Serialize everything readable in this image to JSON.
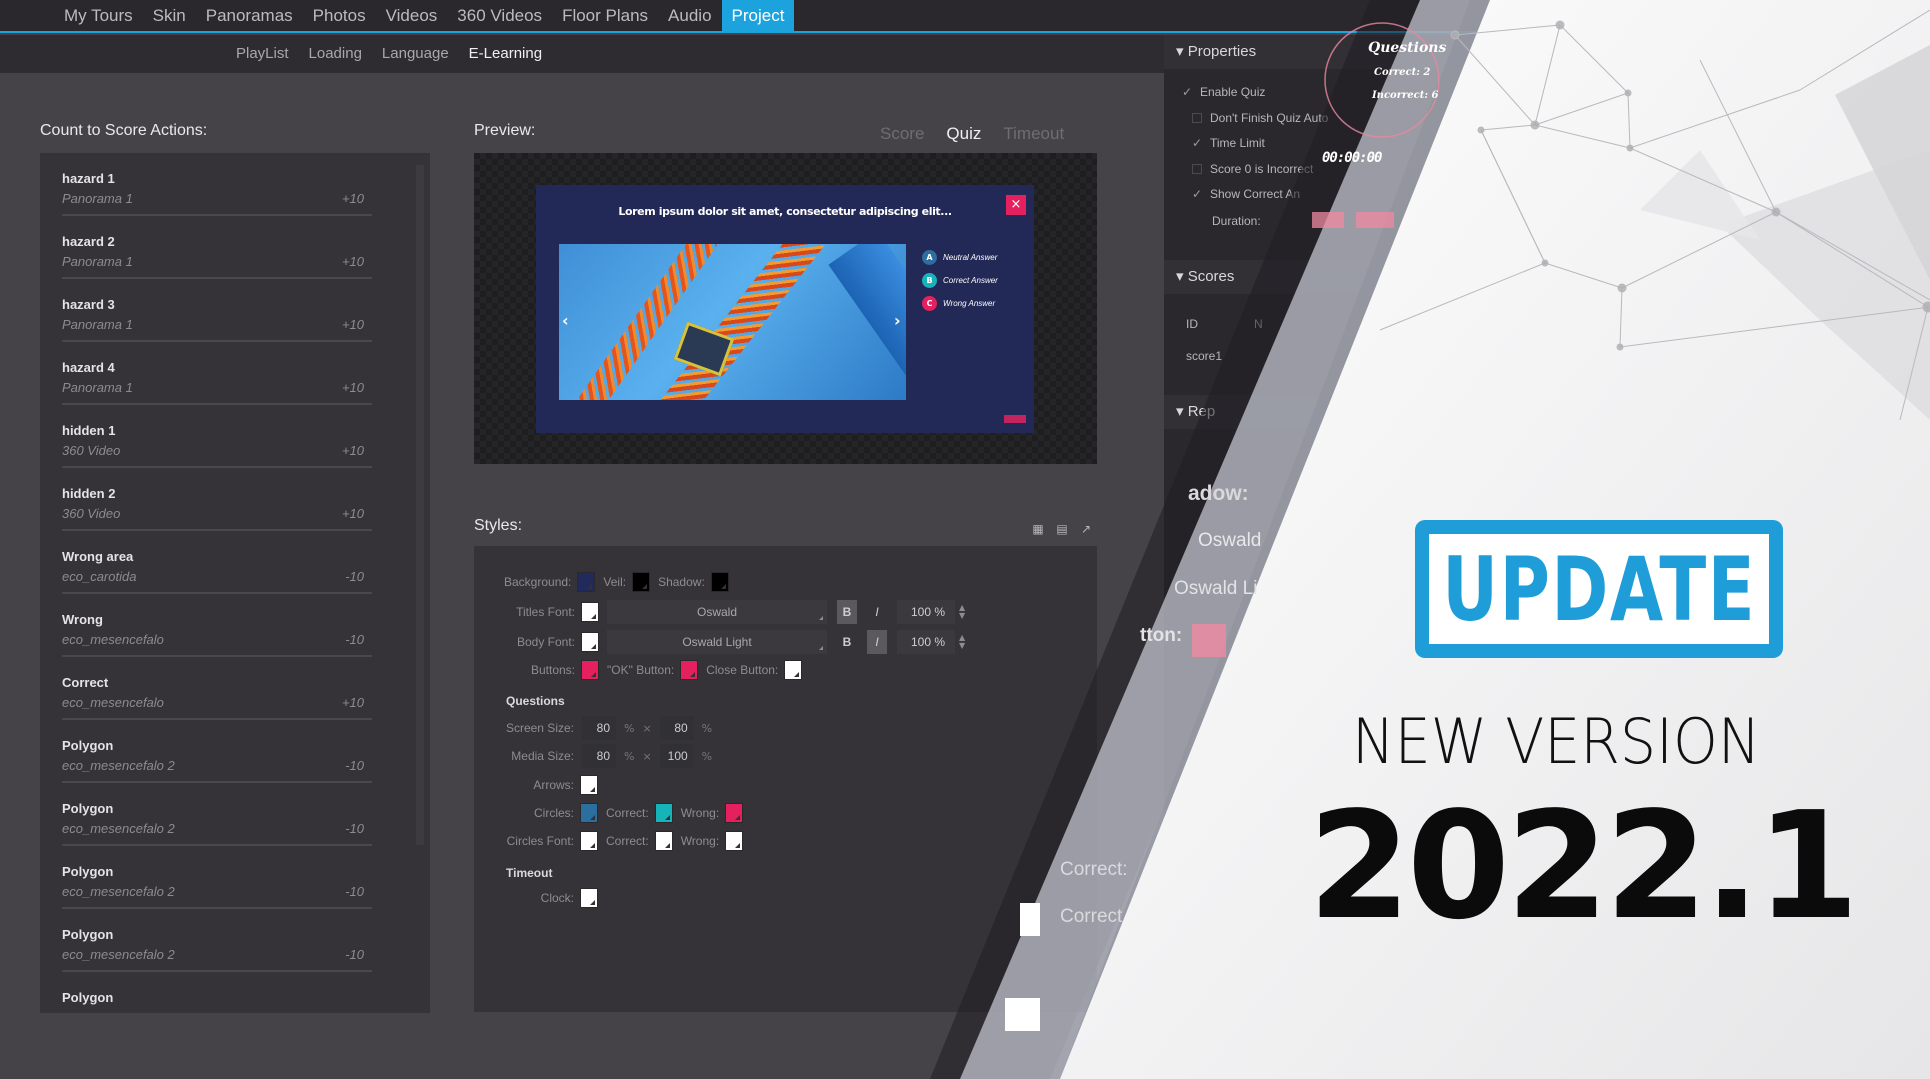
{
  "topnav": {
    "tabs": [
      "My Tours",
      "Skin",
      "Panoramas",
      "Photos",
      "Videos",
      "360 Videos",
      "Floor Plans",
      "Audio",
      "Project"
    ],
    "active": "Project",
    "accent": "#1ca3dd"
  },
  "subnav": {
    "tabs": [
      "PlayList",
      "Loading",
      "Language",
      "E-Learning"
    ],
    "active": "E-Learning"
  },
  "score_actions": {
    "title": "Count to Score Actions:",
    "items": [
      {
        "name": "hazard 1",
        "source": "Panorama 1",
        "score": "+10"
      },
      {
        "name": "hazard 2",
        "source": "Panorama 1",
        "score": "+10"
      },
      {
        "name": "hazard 3",
        "source": "Panorama 1",
        "score": "+10"
      },
      {
        "name": "hazard 4",
        "source": "Panorama 1",
        "score": "+10"
      },
      {
        "name": "hidden 1",
        "source": "360 Video",
        "score": "+10"
      },
      {
        "name": "hidden 2",
        "source": "360 Video",
        "score": "+10"
      },
      {
        "name": "Wrong area",
        "source": "eco_carotida",
        "score": "-10"
      },
      {
        "name": "Wrong",
        "source": "eco_mesencefalo",
        "score": "-10"
      },
      {
        "name": "Correct",
        "source": "eco_mesencefalo",
        "score": "+10"
      },
      {
        "name": "Polygon",
        "source": "eco_mesencefalo 2",
        "score": "-10"
      },
      {
        "name": "Polygon",
        "source": "eco_mesencefalo 2",
        "score": "-10"
      },
      {
        "name": "Polygon",
        "source": "eco_mesencefalo 2",
        "score": "-10"
      },
      {
        "name": "Polygon",
        "source": "eco_mesencefalo 2",
        "score": "-10"
      },
      {
        "name": "Polygon",
        "source": "",
        "score": ""
      }
    ]
  },
  "preview": {
    "title": "Preview:",
    "tabs": [
      "Score",
      "Quiz",
      "Timeout"
    ],
    "active": "Quiz",
    "quiz": {
      "question": "Lorem ipsum dolor sit amet, consectetur adipiscing elit...",
      "close_glyph": "×",
      "prev_arrow": "‹",
      "next_arrow": "›",
      "answers": [
        {
          "letter": "A",
          "label": "Neutral Answer",
          "color": "#2d6e9e"
        },
        {
          "letter": "B",
          "label": "Correct Answer",
          "color": "#16b3b8"
        },
        {
          "letter": "C",
          "label": "Wrong Answer",
          "color": "#e5205e"
        }
      ]
    }
  },
  "styles": {
    "title": "Styles:",
    "icons": [
      "grid-icon",
      "save-icon",
      "export-icon"
    ],
    "icon_glyphs": [
      "▦",
      "💾",
      "↗"
    ],
    "background_label": "Background:",
    "background_color": "#222a5c",
    "veil_label": "Veil:",
    "veil_color": "#000000",
    "shadow_label": "Shadow:",
    "shadow_color": "#000000",
    "titles_font_label": "Titles Font:",
    "titles_font_color": "#ffffff",
    "titles_font": "Oswald",
    "titles_bold": "B",
    "titles_italic": "I",
    "titles_size": "100 %",
    "body_font_label": "Body Font:",
    "body_font_color": "#ffffff",
    "body_font": "Oswald Light",
    "body_bold": "B",
    "body_italic": "I",
    "body_size": "100 %",
    "buttons_label": "Buttons:",
    "buttons_color": "#e5205e",
    "ok_button_label": "\"OK\" Button:",
    "ok_button_color": "#e5205e",
    "close_button_label": "Close Button:",
    "close_button_color": "#ffffff",
    "questions_heading": "Questions",
    "screen_size_label": "Screen Size:",
    "screen_w": "80",
    "screen_h": "80",
    "media_size_label": "Media Size:",
    "media_w": "80",
    "media_h": "100",
    "percent": "%",
    "times": "×",
    "arrows_label": "Arrows:",
    "arrows_color": "#ffffff",
    "circles_label": "Circles:",
    "circles_color": "#2a6f9d",
    "correct_label": "Correct:",
    "correct_color": "#16b3b8",
    "wrong_label": "Wrong:",
    "wrong_color": "#e5205e",
    "circles_font_label": "Circles Font:",
    "circles_font_color": "#ffffff",
    "correct_font_color": "#ffffff",
    "wrong_font_color": "#ffffff",
    "timeout_heading": "Timeout",
    "clock_label": "Clock:",
    "clock_color": "#ffffff"
  },
  "properties": {
    "header": "Properties",
    "enable_quiz": "Enable Quiz",
    "dont_finish": "Don't Finish Quiz Auto",
    "time_limit": "Time Limit",
    "score_zero": "Score 0 is Incorrect",
    "show_correct": "Show Correct An",
    "duration_label": "Duration:",
    "scores_header": "Scores",
    "scores_col_id": "ID",
    "scores_col_n": "N",
    "score_row": "score1",
    "rep_header": "Rep",
    "overlay_questions": "Questions",
    "overlay_correct": "Correct: 2",
    "overlay_incorrect": "Incorrect: 6",
    "overlay_timer": "00:00:00"
  },
  "ghost": {
    "shadow": "adow:",
    "oswald": "Oswald",
    "oswald_light": "Oswald Li",
    "button": "tton:",
    "correct1": "Correct:",
    "correct2": "Correct"
  },
  "promo": {
    "stamp": "UPDATE",
    "stamp_color": "#1f9dd8",
    "new_version": "NEW VERSION",
    "version": "2022.1"
  }
}
